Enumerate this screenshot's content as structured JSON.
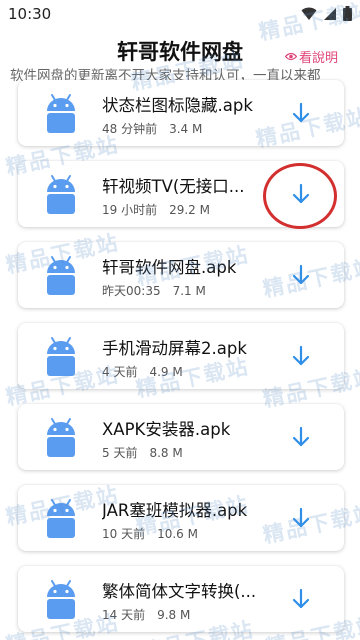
{
  "status": {
    "time": "10:30"
  },
  "header": {
    "title": "轩哥软件网盘",
    "help_label": "看說明",
    "subtitle": "软件网盘的更新离不开大家支持和认可，一直以来都"
  },
  "files": [
    {
      "name": "状态栏图标隐藏.apk",
      "time": "48 分钟前",
      "size": "3.4 M"
    },
    {
      "name": "轩视频TV(无接口...",
      "time": "19 小时前",
      "size": "29.2 M"
    },
    {
      "name": "轩哥软件网盘.apk",
      "time": "昨天00:35",
      "size": "7.1 M"
    },
    {
      "name": "手机滑动屏幕2.apk",
      "time": "4 天前",
      "size": "4.9 M"
    },
    {
      "name": "XAPK安装器.apk",
      "time": "5 天前",
      "size": "8.8 M"
    },
    {
      "name": "JAR塞班模拟器.apk",
      "time": "10 天前",
      "size": "10.6 M"
    },
    {
      "name": "繁体简体文字转换(...",
      "time": "14 天前",
      "size": "9.8 M"
    }
  ],
  "watermark_text": "精品下载站",
  "colors": {
    "accent": "#2f8fe8",
    "android": "#5a9cf0",
    "highlight": "#d32f2f",
    "help": "#e0457a"
  },
  "icons": {
    "file_icon": "android-robot-icon",
    "download": "download-arrow-icon"
  }
}
